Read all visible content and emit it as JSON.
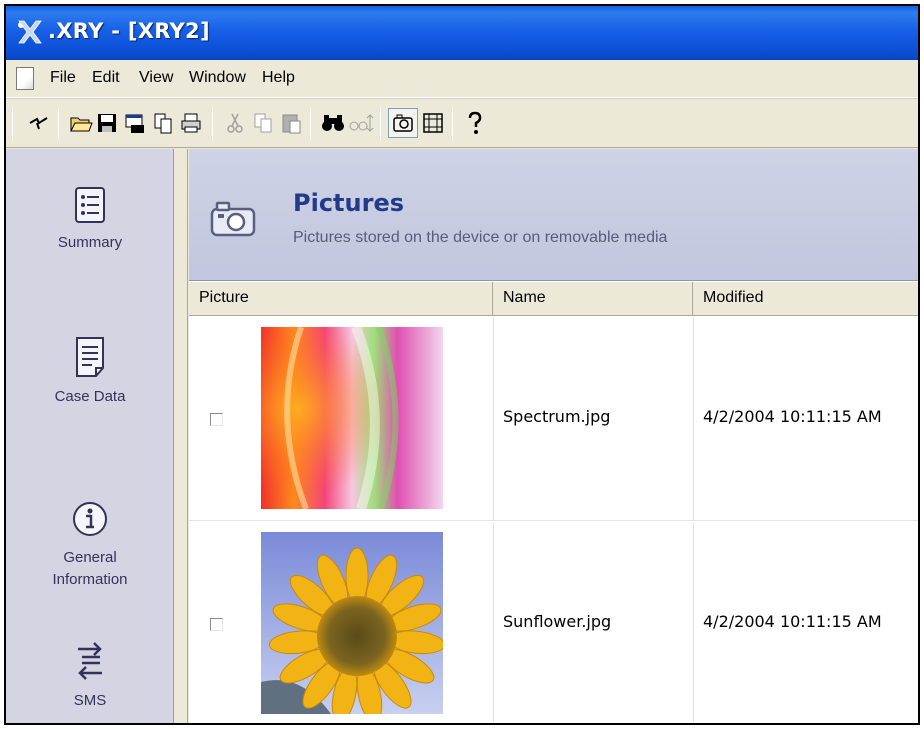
{
  "window": {
    "title": ".XRY - [XRY2]"
  },
  "menu": {
    "items": [
      "File",
      "Edit",
      "View",
      "Window",
      "Help"
    ]
  },
  "toolbar": {
    "icons": [
      "connect-icon",
      "open-icon",
      "save-icon",
      "export-icon",
      "copy-case-icon",
      "print-icon",
      "cut-icon",
      "copy-icon",
      "paste-icon",
      "find-icon",
      "find-next-icon",
      "picture-view-icon",
      "film-view-icon",
      "help-icon"
    ]
  },
  "nav": {
    "items": [
      {
        "label": "Summary",
        "icon": "summary-icon"
      },
      {
        "label": "Case Data",
        "icon": "case-data-icon"
      },
      {
        "label": "General\nInformation",
        "icon": "info-icon"
      },
      {
        "label": "SMS",
        "icon": "sms-icon"
      }
    ]
  },
  "header": {
    "title": "Pictures",
    "subtitle": "Pictures stored on the device or on removable media",
    "icon": "camera-icon"
  },
  "table": {
    "columns": [
      "Picture",
      "Name",
      "Modified"
    ],
    "rows": [
      {
        "picture": "spectrum-thumbnail",
        "name": "Spectrum.jpg",
        "modified": "4/2/2004 10:11:15 AM",
        "checked": false
      },
      {
        "picture": "sunflower-thumbnail",
        "name": "Sunflower.jpg",
        "modified": "4/2/2004 10:11:15 AM",
        "checked": false
      }
    ]
  },
  "colors": {
    "titlebar": "#0b4fd6",
    "nav_bg": "#d4d4e2",
    "header_title": "#1f3b8a"
  }
}
